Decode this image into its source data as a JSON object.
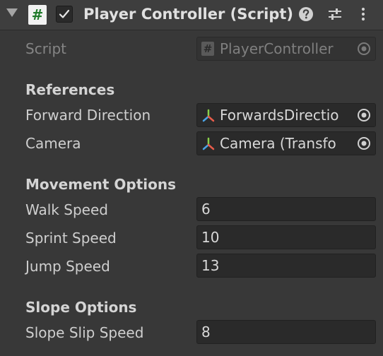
{
  "header": {
    "title": "Player Controller (Script)",
    "enabled": true,
    "script_icon_glyph": "#"
  },
  "script_field": {
    "label": "Script",
    "value": "PlayerController"
  },
  "sections": {
    "references": "References",
    "movement": "Movement Options",
    "slope": "Slope Options"
  },
  "references": {
    "forward_direction": {
      "label": "Forward Direction",
      "value": "ForwardsDirectio"
    },
    "camera": {
      "label": "Camera",
      "value": "Camera (Transfo"
    }
  },
  "movement": {
    "walk_speed": {
      "label": "Walk Speed",
      "value": "6"
    },
    "sprint_speed": {
      "label": "Sprint Speed",
      "value": "10"
    },
    "jump_speed": {
      "label": "Jump Speed",
      "value": "13"
    }
  },
  "slope": {
    "slope_slip_speed": {
      "label": "Slope Slip Speed",
      "value": "8"
    }
  },
  "colors": {
    "background": "#383838",
    "header": "#3e3e3e",
    "field": "#2a2a2a",
    "script_icon_green": "#1f7a2a"
  },
  "icons": [
    "foldout-arrow-icon",
    "script-icon",
    "checkmark-icon",
    "help-icon",
    "settings-sliders-icon",
    "more-options-icon",
    "transform-axis-icon",
    "object-picker-icon"
  ]
}
